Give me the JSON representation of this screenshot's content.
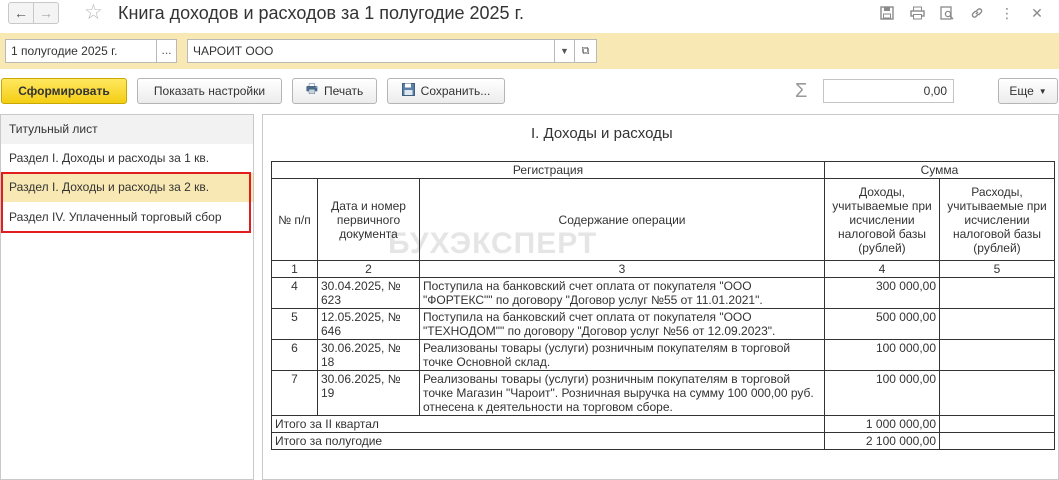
{
  "window": {
    "title": "Книга доходов и расходов за 1 полугодие 2025 г."
  },
  "params": {
    "period": "1 полугодие 2025 г.",
    "period_button": "...",
    "organization": "ЧАРОИТ ООО"
  },
  "toolbar": {
    "generate": "Сформировать",
    "settings": "Показать настройки",
    "print": "Печать",
    "save": "Сохранить...",
    "sum_value": "0,00",
    "more": "Еще"
  },
  "sections": [
    {
      "label": "Титульный лист"
    },
    {
      "label": "Раздел I. Доходы и расходы за 1 кв."
    },
    {
      "label": "Раздел I. Доходы и расходы за 2 кв."
    },
    {
      "label": "Раздел IV. Уплаченный торговый сбор"
    }
  ],
  "report": {
    "title": "I. Доходы и расходы",
    "watermark": "БУХЭКСПЕРТ",
    "headers": {
      "registration": "Регистрация",
      "sum": "Сумма",
      "num": "№ п/п",
      "date": "Дата и номер первичного документа",
      "content": "Содержание операции",
      "income": "Доходы, учитываемые при исчислении налоговой базы (рублей)",
      "expense": "Расходы, учитываемые при исчислении налоговой базы (рублей)"
    },
    "col_numbers": [
      "1",
      "2",
      "3",
      "4",
      "5"
    ],
    "rows": [
      {
        "num": "4",
        "doc": "30.04.2025, № 623",
        "content": "Поступила на банковский счет оплата от покупателя \"ООО \"ФОРТЕКС\"\" по договору \"Договор услуг №55 от 11.01.2021\".",
        "income": "300 000,00",
        "expense": ""
      },
      {
        "num": "5",
        "doc": "12.05.2025, № 646",
        "content": "Поступила на банковский счет оплата от покупателя \"ООО \"ТЕХНОДОМ\"\" по договору \"Договор услуг №56 от 12.09.2023\".",
        "income": "500 000,00",
        "expense": ""
      },
      {
        "num": "6",
        "doc": "30.06.2025, № 18",
        "content": "Реализованы товары (услуги) розничным покупателям в торговой точке Основной склад.",
        "income": "100 000,00",
        "expense": ""
      },
      {
        "num": "7",
        "doc": "30.06.2025, № 19",
        "content": "Реализованы товары (услуги) розничным покупателям в торговой точке Магазин \"Чароит\". Розничная выручка на сумму 100 000,00 руб. отнесена к деятельности на торговом сборе.",
        "income": "100 000,00",
        "expense": ""
      }
    ],
    "totals": [
      {
        "label": "Итого за II квартал",
        "income": "1 000 000,00",
        "expense": ""
      },
      {
        "label": "Итого за полугодие",
        "income": "2 100 000,00",
        "expense": ""
      }
    ]
  }
}
